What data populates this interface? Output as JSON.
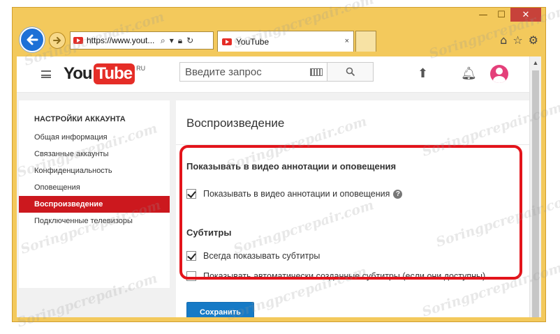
{
  "browser": {
    "address": {
      "url": "https://www.yout..."
    },
    "tab": {
      "title": "YouTube",
      "close_glyph": "×"
    },
    "caption": {
      "minimize": "—",
      "maximize": "☐",
      "close": "✕"
    },
    "tools": [
      "home-icon",
      "star-icon",
      "gear-icon"
    ]
  },
  "header": {
    "logo_you": "You",
    "logo_tube": "Tube",
    "logo_region": "RU",
    "search_placeholder": "Введите запрос"
  },
  "sidebar": {
    "heading": "НАСТРОЙКИ АККАУНТА",
    "items": [
      {
        "label": "Общая информация",
        "active": false
      },
      {
        "label": "Связанные аккаунты",
        "active": false
      },
      {
        "label": "Конфиденциальность",
        "active": false
      },
      {
        "label": "Оповещения",
        "active": false
      },
      {
        "label": "Воспроизведение",
        "active": true
      },
      {
        "label": "Подключенные телевизоры",
        "active": false
      }
    ]
  },
  "main": {
    "title": "Воспроизведение",
    "annotations": {
      "heading": "Показывать в видео аннотации и оповещения",
      "option_label": "Показывать в видео аннотации и оповещения",
      "option_checked": true,
      "help_glyph": "?"
    },
    "subtitles": {
      "heading": "Субтитры",
      "options": [
        {
          "label": "Всегда показывать субтитры",
          "checked": true
        },
        {
          "label": "Показывать автоматически созданные субтитры (если они доступны)",
          "checked": false
        }
      ]
    },
    "save_label": "Сохранить"
  },
  "colors": {
    "window_frame": "#f3c95c",
    "accent_red": "#cc181e",
    "highlight_red": "#e3141b",
    "button_blue": "#167ac6"
  },
  "watermark": "Soringpcrepair.com"
}
